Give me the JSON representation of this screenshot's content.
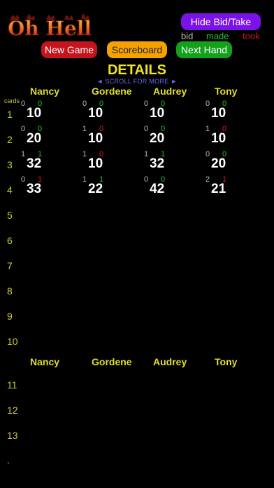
{
  "app": {
    "logo_text": "Oh Hell"
  },
  "buttons": {
    "hide_bid_take": "Hide Bid/Take",
    "new_game": "New Game",
    "scoreboard": "Scoreboard",
    "next_hand": "Next Hand"
  },
  "legend": {
    "bid": "bid",
    "made": "made",
    "took": "took"
  },
  "title": "DETAILS",
  "scroll_hint": "◄ SCROLL FOR MORE ►",
  "cards_label": "cards",
  "players": [
    "Nancy",
    "Gordene",
    "Audrey",
    "Tony"
  ],
  "round_numbers": [
    "1",
    "2",
    "3",
    "4",
    "5",
    "6",
    "7",
    "8",
    "9",
    "10",
    "11",
    "12",
    "13"
  ],
  "rounds": [
    [
      {
        "bid": "0",
        "took": "0",
        "total": "10",
        "made": true
      },
      {
        "bid": "0",
        "took": "0",
        "total": "10",
        "made": true
      },
      {
        "bid": "0",
        "took": "0",
        "total": "10",
        "made": true
      },
      {
        "bid": "0",
        "took": "0",
        "total": "10",
        "made": true
      }
    ],
    [
      {
        "bid": "0",
        "took": "0",
        "total": "20",
        "made": true
      },
      {
        "bid": "1",
        "took": "0",
        "total": "10",
        "made": false
      },
      {
        "bid": "0",
        "took": "0",
        "total": "20",
        "made": true
      },
      {
        "bid": "1",
        "took": "0",
        "total": "10",
        "made": false
      }
    ],
    [
      {
        "bid": "1",
        "took": "1",
        "total": "32",
        "made": true
      },
      {
        "bid": "1",
        "took": "0",
        "total": "10",
        "made": false
      },
      {
        "bid": "1",
        "took": "1",
        "total": "32",
        "made": true
      },
      {
        "bid": "0",
        "took": "0",
        "total": "20",
        "made": true
      }
    ],
    [
      {
        "bid": "0",
        "took": "1",
        "total": "33",
        "made": false
      },
      {
        "bid": "1",
        "took": "1",
        "total": "22",
        "made": true
      },
      {
        "bid": "0",
        "took": "0",
        "total": "42",
        "made": true
      },
      {
        "bid": "2",
        "took": "1",
        "total": "21",
        "made": false
      }
    ]
  ],
  "trailing_mark": ".",
  "colors": {
    "background": "#000000",
    "accent_yellow": "#f0e224",
    "made_green": "#27c12c",
    "missed_red": "#e01818",
    "purple_button": "#7b12e8",
    "red_button": "#c4141c",
    "orange_button": "#f5a100",
    "green_button": "#13a11b"
  }
}
